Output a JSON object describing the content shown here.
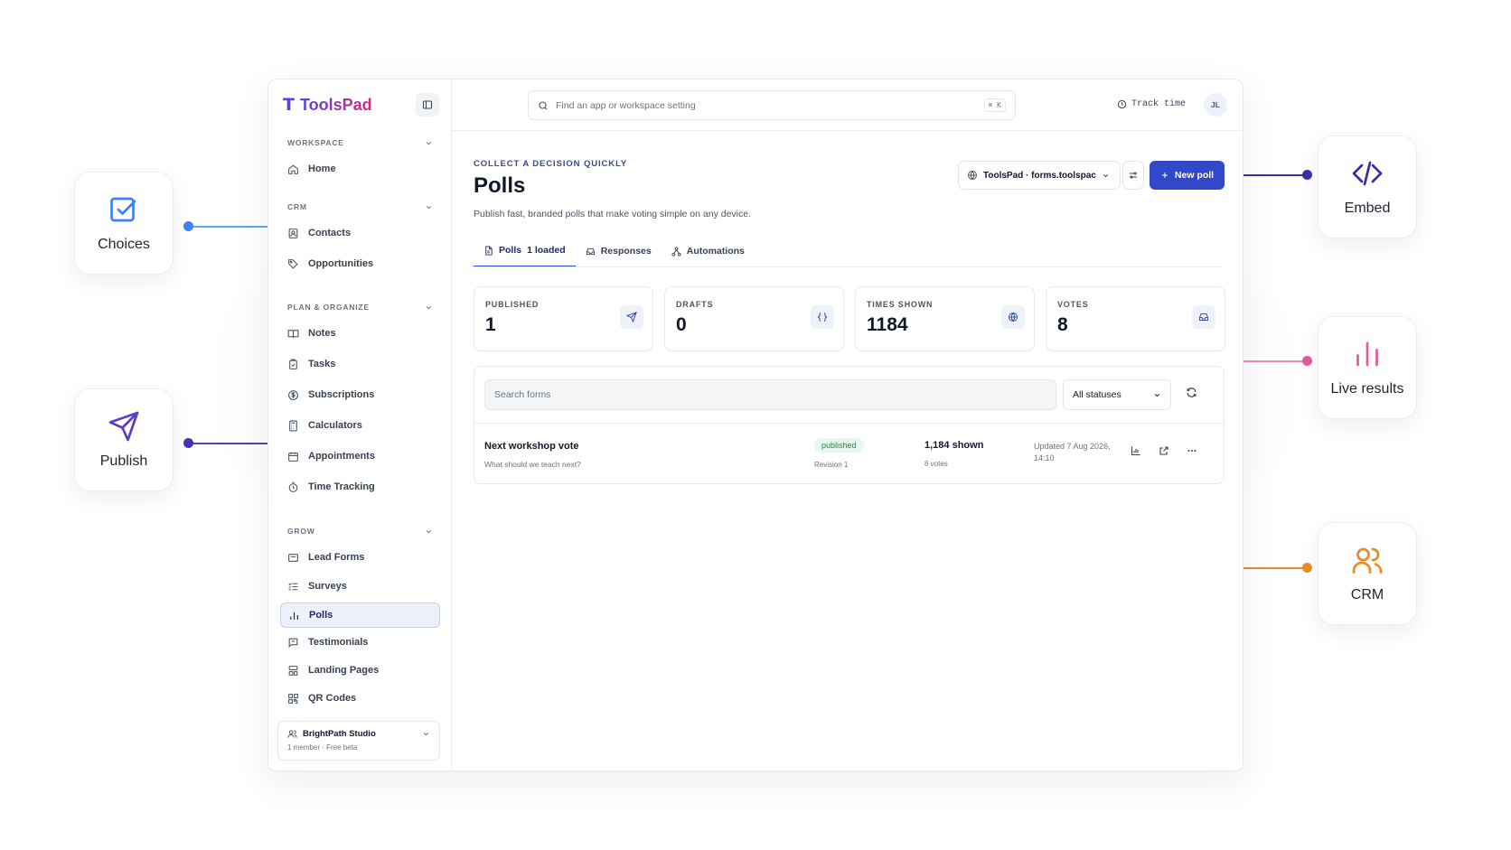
{
  "features": {
    "choices": {
      "label": "Choices",
      "icon": "checkbox-icon",
      "color": "#3b82f6"
    },
    "publish": {
      "label": "Publish",
      "icon": "send-icon",
      "color": "#5b3cc4"
    },
    "embed": {
      "label": "Embed",
      "icon": "code-icon",
      "color": "#3730a3"
    },
    "live_results": {
      "label": "Live results",
      "icon": "bar-chart-icon",
      "color": "#e05a9c"
    },
    "crm": {
      "label": "CRM",
      "icon": "users-icon",
      "color": "#ea8a2b"
    }
  },
  "app": {
    "brand": {
      "mark": "T",
      "name": "ToolsPad"
    },
    "sidebar": {
      "sections": [
        {
          "title": "WORKSPACE",
          "items": [
            {
              "label": "Home",
              "icon": "home-icon"
            }
          ]
        },
        {
          "title": "CRM",
          "items": [
            {
              "label": "Contacts",
              "icon": "contacts-icon"
            },
            {
              "label": "Opportunities",
              "icon": "tag-icon"
            }
          ]
        },
        {
          "title": "PLAN & ORGANIZE",
          "items": [
            {
              "label": "Notes",
              "icon": "book-icon"
            },
            {
              "label": "Tasks",
              "icon": "clipboard-icon"
            },
            {
              "label": "Subscriptions",
              "icon": "dollar-icon"
            },
            {
              "label": "Calculators",
              "icon": "calculator-icon"
            },
            {
              "label": "Appointments",
              "icon": "calendar-icon"
            },
            {
              "label": "Time Tracking",
              "icon": "stopwatch-icon"
            }
          ]
        },
        {
          "title": "GROW",
          "items": [
            {
              "label": "Lead Forms",
              "icon": "form-icon"
            },
            {
              "label": "Surveys",
              "icon": "list-check-icon"
            },
            {
              "label": "Polls",
              "icon": "bar-chart-icon",
              "active": true
            },
            {
              "label": "Testimonials",
              "icon": "message-icon"
            },
            {
              "label": "Landing Pages",
              "icon": "layout-icon"
            },
            {
              "label": "QR Codes",
              "icon": "qr-icon"
            }
          ]
        }
      ],
      "workspace_card": {
        "name": "BrightPath Studio",
        "sub": "1 member · Free beta"
      }
    },
    "topbar": {
      "search_placeholder": "Find an app or workspace setting",
      "shortcut": "⌘ K",
      "track_time": "Track time",
      "avatar": "JL"
    },
    "header": {
      "eyebrow": "COLLECT A DECISION QUICKLY",
      "title": "Polls",
      "subtitle": "Publish fast, branded polls that make voting simple on any device.",
      "workspace_select": "ToolsPad · forms.toolspac",
      "new_button": "New poll"
    },
    "tabs": [
      {
        "label": "Polls",
        "count": "1 loaded",
        "icon": "file-icon",
        "active": true
      },
      {
        "label": "Responses",
        "icon": "inbox-icon"
      },
      {
        "label": "Automations",
        "icon": "automation-icon"
      }
    ],
    "stats": [
      {
        "label": "PUBLISHED",
        "value": "1",
        "icon": "send-icon"
      },
      {
        "label": "DRAFTS",
        "value": "0",
        "icon": "braces-icon"
      },
      {
        "label": "TIMES SHOWN",
        "value": "1184",
        "icon": "globe-icon"
      },
      {
        "label": "VOTES",
        "value": "8",
        "icon": "inbox-icon"
      }
    ],
    "list": {
      "search_placeholder": "Search forms",
      "status_filter": "All statuses",
      "rows": [
        {
          "title": "Next workshop vote",
          "subtitle": "What should we teach next?",
          "status": "published",
          "revision": "Revision 1",
          "shown": "1,184 shown",
          "votes": "8 votes",
          "updated": "Updated 7 Aug 2026, 14:10"
        }
      ]
    }
  }
}
